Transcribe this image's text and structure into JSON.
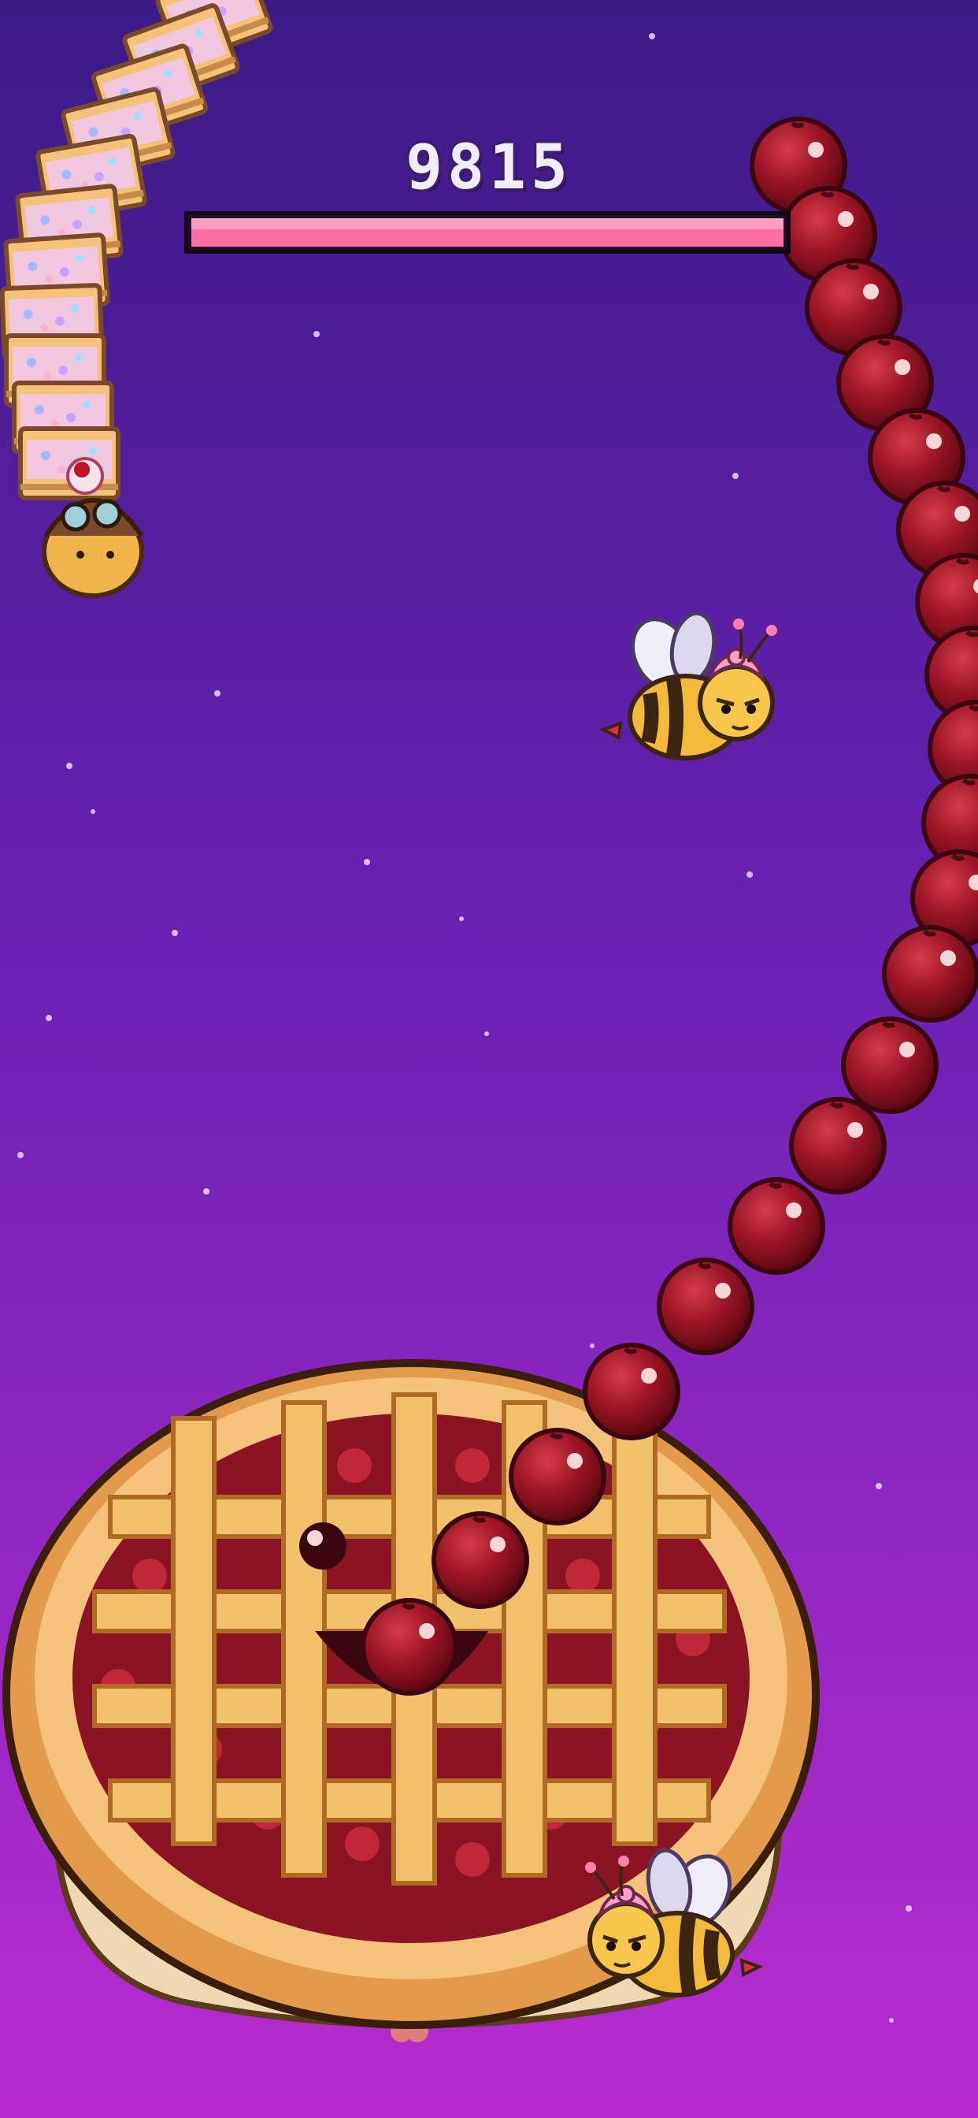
{
  "hud": {
    "score": "9815",
    "health_fraction": 1.0
  },
  "colors": {
    "bg_top": "#3b1a86",
    "bg_bottom": "#b82bd0",
    "cherry": "#9a1426",
    "crust": "#e9ad5e",
    "health_bar": "#ff6fa3"
  },
  "sprites": {
    "worm": "cupcake-worm-with-aviator-goggles",
    "bee_top": "angry-bee-with-pink-frosting-hat",
    "bee_bottom": "angry-bee-with-pink-frosting-hat",
    "pie": "cherry-lattice-pie-with-face"
  }
}
